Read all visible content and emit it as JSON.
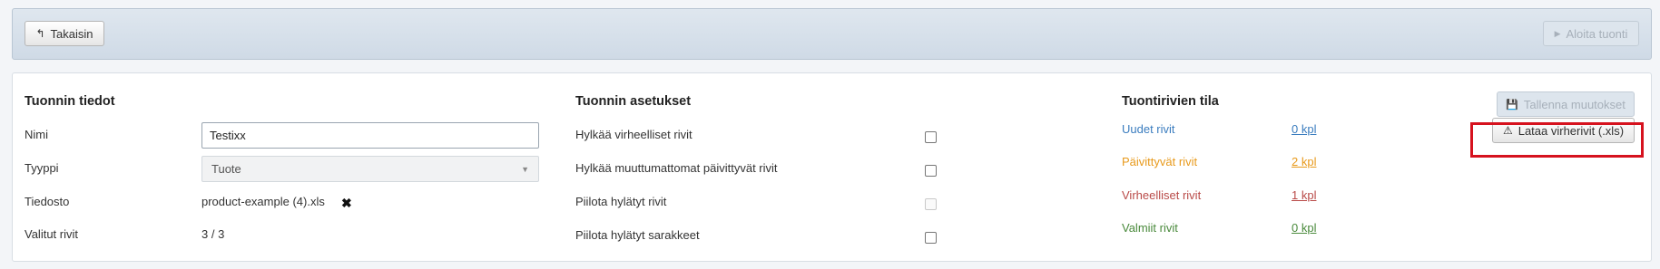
{
  "toolbar": {
    "back_label": "Takaisin",
    "start_label": "Aloita tuonti"
  },
  "details": {
    "title": "Tuonnin tiedot",
    "name_label": "Nimi",
    "name_value": "Testixx",
    "type_label": "Tyyppi",
    "type_value": "Tuote",
    "file_label": "Tiedosto",
    "file_value": "product-example (4).xls",
    "selected_label": "Valitut rivit",
    "selected_value": "3 / 3"
  },
  "settings": {
    "title": "Tuonnin asetukset",
    "options": [
      {
        "label": "Hylkää virheelliset rivit",
        "checked": false,
        "disabled": false
      },
      {
        "label": "Hylkää muuttumattomat päivittyvät rivit",
        "checked": false,
        "disabled": false
      },
      {
        "label": "Piilota hylätyt rivit",
        "checked": false,
        "disabled": true
      },
      {
        "label": "Piilota hylätyt sarakkeet",
        "checked": false,
        "disabled": false
      }
    ]
  },
  "status": {
    "title": "Tuontirivien tila",
    "rows": [
      {
        "label": "Uudet rivit",
        "count": "0 kpl",
        "color": "#3b7dbf"
      },
      {
        "label": "Päivittyvät rivit",
        "count": "2 kpl",
        "color": "#e89a1c"
      },
      {
        "label": "Virheelliset rivit",
        "count": "1 kpl",
        "color": "#b94a48"
      },
      {
        "label": "Valmiit rivit",
        "count": "0 kpl",
        "color": "#4a8a3c"
      }
    ],
    "save_label": "Tallenna muutokset",
    "download_label": "Lataa virherivit (.xls)"
  },
  "colors": {
    "highlight": "#d6121e"
  }
}
